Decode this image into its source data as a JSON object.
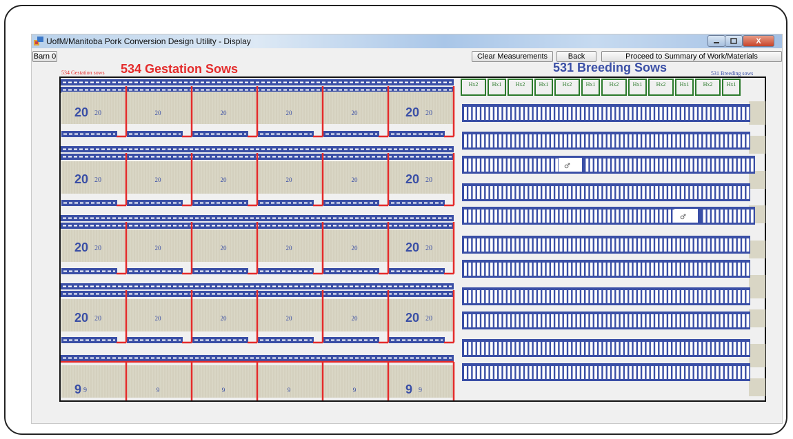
{
  "window": {
    "title": "UofM/Manitoba Pork Conversion Design Utility - Display",
    "minimize_icon": "minimize-icon",
    "maximize_icon": "maximize-icon",
    "close_icon": "close-icon",
    "close_glyph": "X"
  },
  "toolbar": {
    "barn_label": "Barn 0",
    "clear_label": "Clear Measurements",
    "back_label": "Back",
    "proceed_label": "Proceed to Summary of Work/Materials"
  },
  "gestation": {
    "heading": "534 Gestation Sows",
    "small_label": "534 Gestation sows",
    "rows": [
      {
        "big": "20",
        "small": "20",
        "pens": [
          "20",
          "20",
          "20",
          "20",
          "20",
          "20"
        ]
      },
      {
        "big": "20",
        "small": "20",
        "pens": [
          "20",
          "20",
          "20",
          "20",
          "20",
          "20"
        ]
      },
      {
        "big": "20",
        "small": "20",
        "pens": [
          "20",
          "20",
          "20",
          "20",
          "20",
          "20"
        ]
      },
      {
        "big": "20",
        "small": "20",
        "pens": [
          "20",
          "20",
          "20",
          "20",
          "20",
          "20"
        ]
      },
      {
        "big": "9",
        "small": "9",
        "pens": [
          "9",
          "9",
          "9",
          "9",
          "9",
          "9"
        ]
      }
    ]
  },
  "breeding": {
    "heading": "531 Breeding Sows",
    "small_label": "531 Breeding sows",
    "hx_labels": [
      "Hx2",
      "Hx1",
      "Hx2",
      "Hx1",
      "Hx2",
      "Hx1",
      "Hx2",
      "Hx1",
      "Hx2",
      "Hx1",
      "Hx2",
      "Hx1"
    ],
    "boar_symbol": "♂"
  },
  "colors": {
    "pen_wall": "#e42b2b",
    "feeder": "#3a4fa6",
    "pen_floor": "#d9d6c5",
    "hx_border": "#2b7a2b",
    "gestation_text": "#e42b2b",
    "breeding_text": "#3a4fa6"
  }
}
